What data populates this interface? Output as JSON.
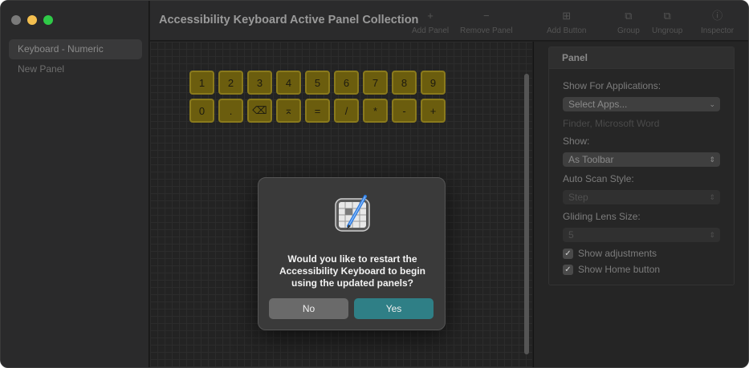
{
  "window": {
    "title": "Accessibility Keyboard Active Panel Collection"
  },
  "sidebar": {
    "items": [
      {
        "label": "Keyboard - Numeric",
        "selected": true
      },
      {
        "label": "New Panel",
        "selected": false
      }
    ]
  },
  "toolbar": {
    "buttons": [
      {
        "label": "Add Panel",
        "icon": "plus-icon"
      },
      {
        "label": "Remove Panel",
        "icon": "minus-icon"
      },
      {
        "label": "Add Button",
        "icon": "add-button-icon"
      },
      {
        "label": "Group",
        "icon": "group-icon"
      },
      {
        "label": "Ungroup",
        "icon": "ungroup-icon"
      },
      {
        "label": "Inspector",
        "icon": "info-icon"
      }
    ]
  },
  "keyboard": {
    "row1": [
      "1",
      "2",
      "3",
      "4",
      "5",
      "6",
      "7",
      "8",
      "9"
    ],
    "row2": [
      "0",
      ".",
      "⌫",
      "⌅",
      "=",
      "/",
      "*",
      "-",
      "+"
    ]
  },
  "inspector": {
    "header": "Panel",
    "show_for_apps_label": "Show For Applications:",
    "show_for_apps_value": "Select Apps...",
    "apps_hint": "Finder, Microsoft Word",
    "show_label": "Show:",
    "show_value": "As Toolbar",
    "auto_scan_label": "Auto Scan Style:",
    "auto_scan_value": "Step",
    "gliding_label": "Gliding Lens Size:",
    "gliding_value": "5",
    "check_adjustments": "Show adjustments",
    "check_home": "Show Home button"
  },
  "dialog": {
    "message": "Would you like to restart the Accessibility Keyboard to begin using the updated panels?",
    "no_label": "No",
    "yes_label": "Yes"
  },
  "colors": {
    "key_fill": "#6b5d0e",
    "yes_button": "#2f7f86"
  }
}
